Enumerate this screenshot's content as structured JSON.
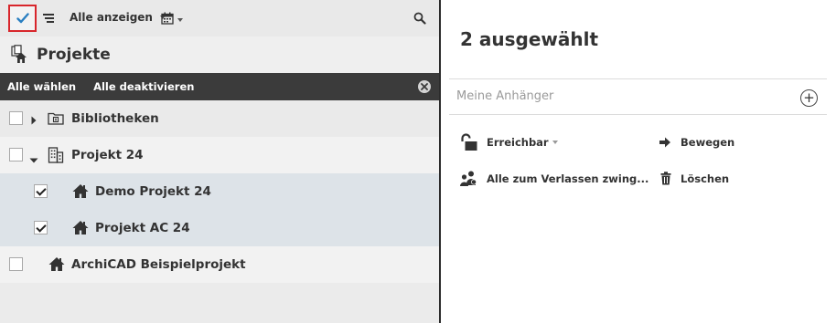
{
  "toolbar": {
    "select_mode_icon": "checkmark-icon",
    "list_icon": "list-icon",
    "filter_label": "Alle anzeigen",
    "calendar_icon": "calendar-icon",
    "search_icon": "search-icon"
  },
  "panel": {
    "title": "Projekte"
  },
  "selection_bar": {
    "select_all": "Alle wählen",
    "deselect_all": "Alle deaktivieren"
  },
  "tree": [
    {
      "label": "Bibliotheken",
      "checked": false,
      "expanded": false,
      "icon": "library-folder-icon"
    },
    {
      "label": "Projekt 24",
      "checked": false,
      "expanded": true,
      "icon": "building-icon"
    },
    {
      "label": "Demo Projekt 24",
      "checked": true,
      "icon": "project-house-icon"
    },
    {
      "label": "Projekt AC 24",
      "checked": true,
      "icon": "project-house-icon"
    },
    {
      "label": "ArchiCAD Beispielprojekt",
      "checked": false,
      "icon": "project-house-icon"
    }
  ],
  "detail": {
    "title": "2 ausgewählt",
    "tags_placeholder": "Meine Anhänger",
    "actions": {
      "access_label": "Erreichbar",
      "move_label": "Bewegen",
      "force_leave_label": "Alle zum Verlassen zwing...",
      "delete_label": "Löschen"
    }
  },
  "colors": {
    "accent_blue": "#2a7fc1",
    "highlight_red": "#d8262c",
    "selection_bar": "#3b3b3b",
    "selected_row": "#dde3e8"
  }
}
